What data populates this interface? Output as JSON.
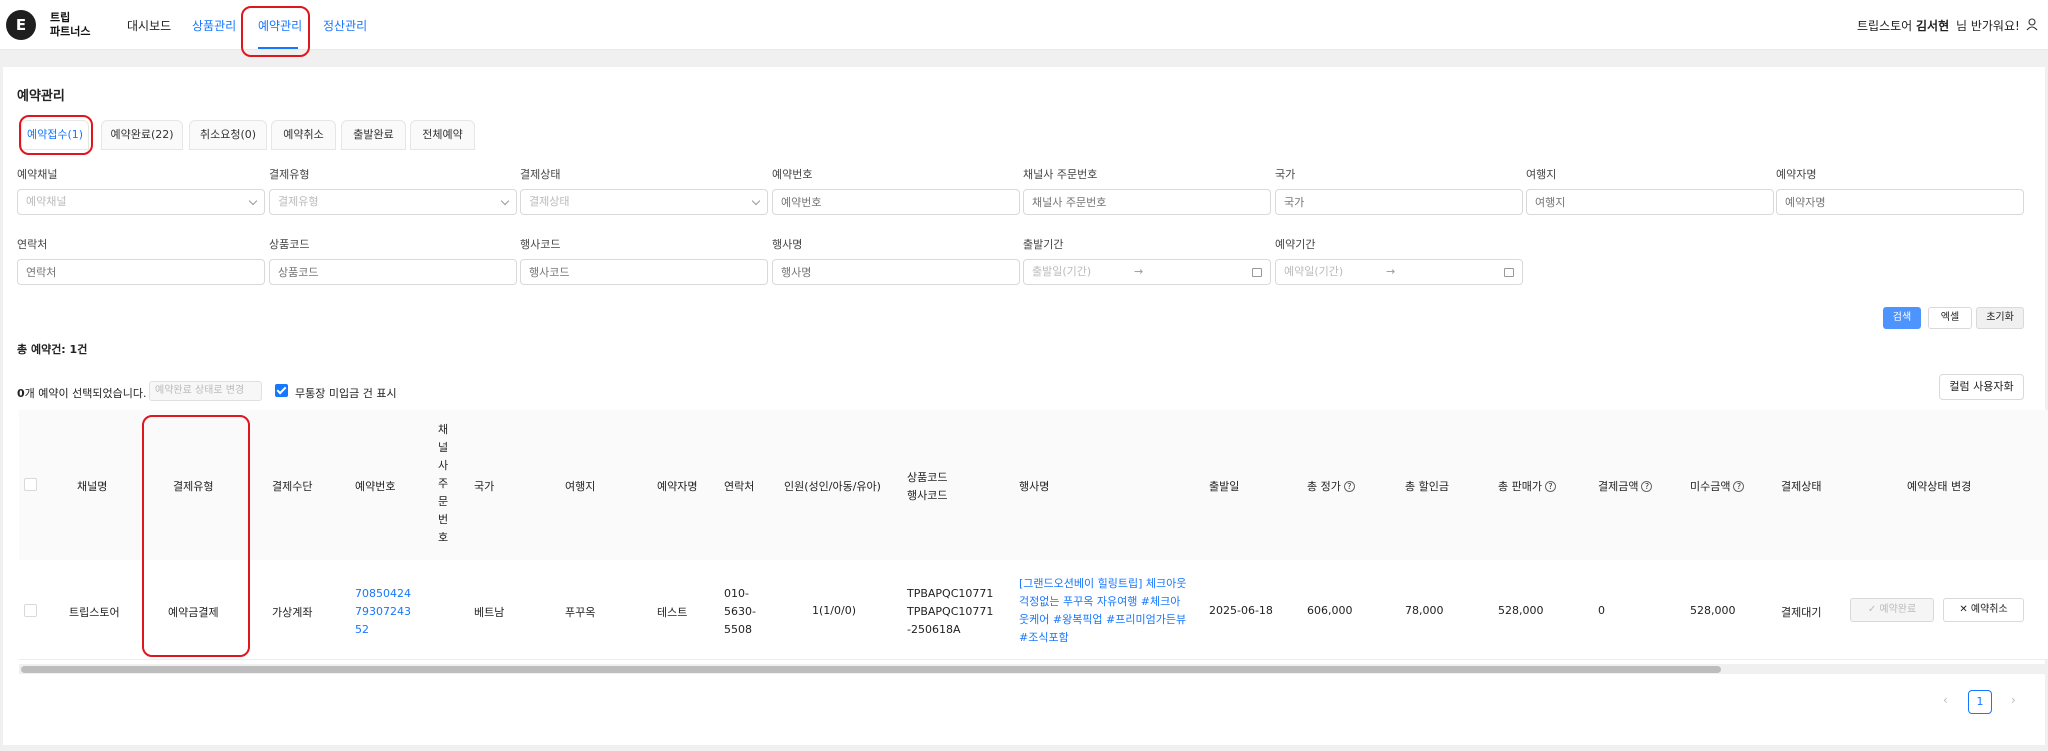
{
  "header": {
    "logo_letter": "E",
    "logo_line1": "트립",
    "logo_line2": "파트너스",
    "nav": [
      "대시보드",
      "상품관리",
      "예약관리",
      "정산관리"
    ],
    "store": "트립스토어",
    "user_name": "김서현",
    "greeting": "님 반가워요!"
  },
  "page": {
    "title": "예약관리",
    "tabs": [
      "예약접수(1)",
      "예약완료(22)",
      "취소요청(0)",
      "예약취소",
      "출발완료",
      "전체예약"
    ]
  },
  "filters": {
    "row1": [
      {
        "label": "예약채널",
        "placeholder": "예약채널"
      },
      {
        "label": "결제유형",
        "placeholder": "결제유형"
      },
      {
        "label": "결제상태",
        "placeholder": "결제상태"
      },
      {
        "label": "예약번호",
        "placeholder": "예약번호"
      },
      {
        "label": "채널사 주문번호",
        "placeholder": "채널사 주문번호"
      },
      {
        "label": "국가",
        "placeholder": "국가"
      },
      {
        "label": "여행지",
        "placeholder": "여행지"
      },
      {
        "label": "예약자명",
        "placeholder": "예약자명"
      }
    ],
    "row2": [
      {
        "label": "연락처",
        "placeholder": "연락처"
      },
      {
        "label": "상품코드",
        "placeholder": "상품코드"
      },
      {
        "label": "행사코드",
        "placeholder": "행사코드"
      },
      {
        "label": "행사명",
        "placeholder": "행사명"
      },
      {
        "label": "출발기간",
        "placeholder": "출발일(기간)"
      },
      {
        "label": "예약기간",
        "placeholder": "예약일(기간)"
      }
    ],
    "arrow": "→"
  },
  "buttons": {
    "search": "검색",
    "excel": "엑셀",
    "reset": "초기화",
    "columns": "컬럼 사용자화"
  },
  "summary": {
    "total": "총 예약건: 1건",
    "selected_count": "0",
    "selected_text": "개 예약이 선택되었습니다.",
    "status_placeholder": "예약완료 상태로 변경",
    "unpaid_label": "무통장 미입금 건 표시"
  },
  "table": {
    "headers": {
      "channel": "채널명",
      "pay_type": "결제유형",
      "pay_method": "결제수단",
      "booking_no": "예약번호",
      "channel_order_chars": [
        "채",
        "널",
        "사",
        "주",
        "문",
        "번",
        "호"
      ],
      "country": "국가",
      "destination": "여행지",
      "booker": "예약자명",
      "contact": "연락처",
      "people": "인원(성인/아동/유아)",
      "product_code": "상품코드",
      "event_code": "행사코드",
      "event_name": "행사명",
      "departure": "출발일",
      "total_price": "총 정가",
      "total_discount": "총 할인금",
      "total_sale": "총 판매가",
      "paid": "결제금액",
      "unpaid": "미수금액",
      "pay_status": "결제상태",
      "change_status": "예약상태 변경"
    },
    "row": {
      "channel": "트립스토어",
      "pay_type": "예약금결제",
      "pay_method": "가상계좌",
      "booking_no": [
        "70850424",
        "79307243",
        "52"
      ],
      "country": "베트남",
      "destination": "푸꾸옥",
      "booker": "테스트",
      "contact": [
        "010-",
        "5630-",
        "5508"
      ],
      "people": "1(1/0/0)",
      "codes": [
        "TPBAPQC10771",
        "TPBAPQC10771",
        "-250618A"
      ],
      "event_name": [
        "[그랜드오션베이 힐링트립] 체크아웃",
        "걱정없는 푸꾸옥 자유여행 #체크아",
        "웃케어 #왕복픽업 #프리미엄가든뷰",
        "#조식포함"
      ],
      "departure": "2025-06-18",
      "total_price": "606,000",
      "total_discount": "78,000",
      "total_sale": "528,000",
      "paid": "0",
      "unpaid": "528,000",
      "pay_status": "결제대기",
      "btn_complete": "예약완료",
      "btn_cancel": "예약취소"
    }
  },
  "pagination": {
    "current": "1",
    "prev": "‹",
    "next": "›"
  }
}
